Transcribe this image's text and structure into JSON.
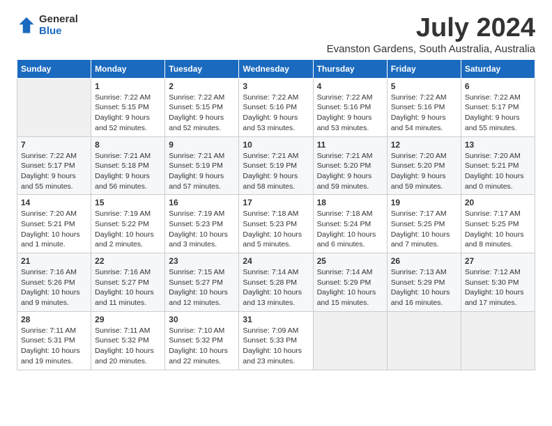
{
  "logo": {
    "general": "General",
    "blue": "Blue"
  },
  "header": {
    "month": "July 2024",
    "location": "Evanston Gardens, South Australia, Australia"
  },
  "weekdays": [
    "Sunday",
    "Monday",
    "Tuesday",
    "Wednesday",
    "Thursday",
    "Friday",
    "Saturday"
  ],
  "weeks": [
    [
      {
        "day": "",
        "sunrise": "",
        "sunset": "",
        "daylight": ""
      },
      {
        "day": "1",
        "sunrise": "Sunrise: 7:22 AM",
        "sunset": "Sunset: 5:15 PM",
        "daylight": "Daylight: 9 hours and 52 minutes."
      },
      {
        "day": "2",
        "sunrise": "Sunrise: 7:22 AM",
        "sunset": "Sunset: 5:15 PM",
        "daylight": "Daylight: 9 hours and 52 minutes."
      },
      {
        "day": "3",
        "sunrise": "Sunrise: 7:22 AM",
        "sunset": "Sunset: 5:16 PM",
        "daylight": "Daylight: 9 hours and 53 minutes."
      },
      {
        "day": "4",
        "sunrise": "Sunrise: 7:22 AM",
        "sunset": "Sunset: 5:16 PM",
        "daylight": "Daylight: 9 hours and 53 minutes."
      },
      {
        "day": "5",
        "sunrise": "Sunrise: 7:22 AM",
        "sunset": "Sunset: 5:16 PM",
        "daylight": "Daylight: 9 hours and 54 minutes."
      },
      {
        "day": "6",
        "sunrise": "Sunrise: 7:22 AM",
        "sunset": "Sunset: 5:17 PM",
        "daylight": "Daylight: 9 hours and 55 minutes."
      }
    ],
    [
      {
        "day": "7",
        "sunrise": "Sunrise: 7:22 AM",
        "sunset": "Sunset: 5:17 PM",
        "daylight": "Daylight: 9 hours and 55 minutes."
      },
      {
        "day": "8",
        "sunrise": "Sunrise: 7:21 AM",
        "sunset": "Sunset: 5:18 PM",
        "daylight": "Daylight: 9 hours and 56 minutes."
      },
      {
        "day": "9",
        "sunrise": "Sunrise: 7:21 AM",
        "sunset": "Sunset: 5:19 PM",
        "daylight": "Daylight: 9 hours and 57 minutes."
      },
      {
        "day": "10",
        "sunrise": "Sunrise: 7:21 AM",
        "sunset": "Sunset: 5:19 PM",
        "daylight": "Daylight: 9 hours and 58 minutes."
      },
      {
        "day": "11",
        "sunrise": "Sunrise: 7:21 AM",
        "sunset": "Sunset: 5:20 PM",
        "daylight": "Daylight: 9 hours and 59 minutes."
      },
      {
        "day": "12",
        "sunrise": "Sunrise: 7:20 AM",
        "sunset": "Sunset: 5:20 PM",
        "daylight": "Daylight: 9 hours and 59 minutes."
      },
      {
        "day": "13",
        "sunrise": "Sunrise: 7:20 AM",
        "sunset": "Sunset: 5:21 PM",
        "daylight": "Daylight: 10 hours and 0 minutes."
      }
    ],
    [
      {
        "day": "14",
        "sunrise": "Sunrise: 7:20 AM",
        "sunset": "Sunset: 5:21 PM",
        "daylight": "Daylight: 10 hours and 1 minute."
      },
      {
        "day": "15",
        "sunrise": "Sunrise: 7:19 AM",
        "sunset": "Sunset: 5:22 PM",
        "daylight": "Daylight: 10 hours and 2 minutes."
      },
      {
        "day": "16",
        "sunrise": "Sunrise: 7:19 AM",
        "sunset": "Sunset: 5:23 PM",
        "daylight": "Daylight: 10 hours and 3 minutes."
      },
      {
        "day": "17",
        "sunrise": "Sunrise: 7:18 AM",
        "sunset": "Sunset: 5:23 PM",
        "daylight": "Daylight: 10 hours and 5 minutes."
      },
      {
        "day": "18",
        "sunrise": "Sunrise: 7:18 AM",
        "sunset": "Sunset: 5:24 PM",
        "daylight": "Daylight: 10 hours and 6 minutes."
      },
      {
        "day": "19",
        "sunrise": "Sunrise: 7:17 AM",
        "sunset": "Sunset: 5:25 PM",
        "daylight": "Daylight: 10 hours and 7 minutes."
      },
      {
        "day": "20",
        "sunrise": "Sunrise: 7:17 AM",
        "sunset": "Sunset: 5:25 PM",
        "daylight": "Daylight: 10 hours and 8 minutes."
      }
    ],
    [
      {
        "day": "21",
        "sunrise": "Sunrise: 7:16 AM",
        "sunset": "Sunset: 5:26 PM",
        "daylight": "Daylight: 10 hours and 9 minutes."
      },
      {
        "day": "22",
        "sunrise": "Sunrise: 7:16 AM",
        "sunset": "Sunset: 5:27 PM",
        "daylight": "Daylight: 10 hours and 11 minutes."
      },
      {
        "day": "23",
        "sunrise": "Sunrise: 7:15 AM",
        "sunset": "Sunset: 5:27 PM",
        "daylight": "Daylight: 10 hours and 12 minutes."
      },
      {
        "day": "24",
        "sunrise": "Sunrise: 7:14 AM",
        "sunset": "Sunset: 5:28 PM",
        "daylight": "Daylight: 10 hours and 13 minutes."
      },
      {
        "day": "25",
        "sunrise": "Sunrise: 7:14 AM",
        "sunset": "Sunset: 5:29 PM",
        "daylight": "Daylight: 10 hours and 15 minutes."
      },
      {
        "day": "26",
        "sunrise": "Sunrise: 7:13 AM",
        "sunset": "Sunset: 5:29 PM",
        "daylight": "Daylight: 10 hours and 16 minutes."
      },
      {
        "day": "27",
        "sunrise": "Sunrise: 7:12 AM",
        "sunset": "Sunset: 5:30 PM",
        "daylight": "Daylight: 10 hours and 17 minutes."
      }
    ],
    [
      {
        "day": "28",
        "sunrise": "Sunrise: 7:11 AM",
        "sunset": "Sunset: 5:31 PM",
        "daylight": "Daylight: 10 hours and 19 minutes."
      },
      {
        "day": "29",
        "sunrise": "Sunrise: 7:11 AM",
        "sunset": "Sunset: 5:32 PM",
        "daylight": "Daylight: 10 hours and 20 minutes."
      },
      {
        "day": "30",
        "sunrise": "Sunrise: 7:10 AM",
        "sunset": "Sunset: 5:32 PM",
        "daylight": "Daylight: 10 hours and 22 minutes."
      },
      {
        "day": "31",
        "sunrise": "Sunrise: 7:09 AM",
        "sunset": "Sunset: 5:33 PM",
        "daylight": "Daylight: 10 hours and 23 minutes."
      },
      {
        "day": "",
        "sunrise": "",
        "sunset": "",
        "daylight": ""
      },
      {
        "day": "",
        "sunrise": "",
        "sunset": "",
        "daylight": ""
      },
      {
        "day": "",
        "sunrise": "",
        "sunset": "",
        "daylight": ""
      }
    ]
  ]
}
